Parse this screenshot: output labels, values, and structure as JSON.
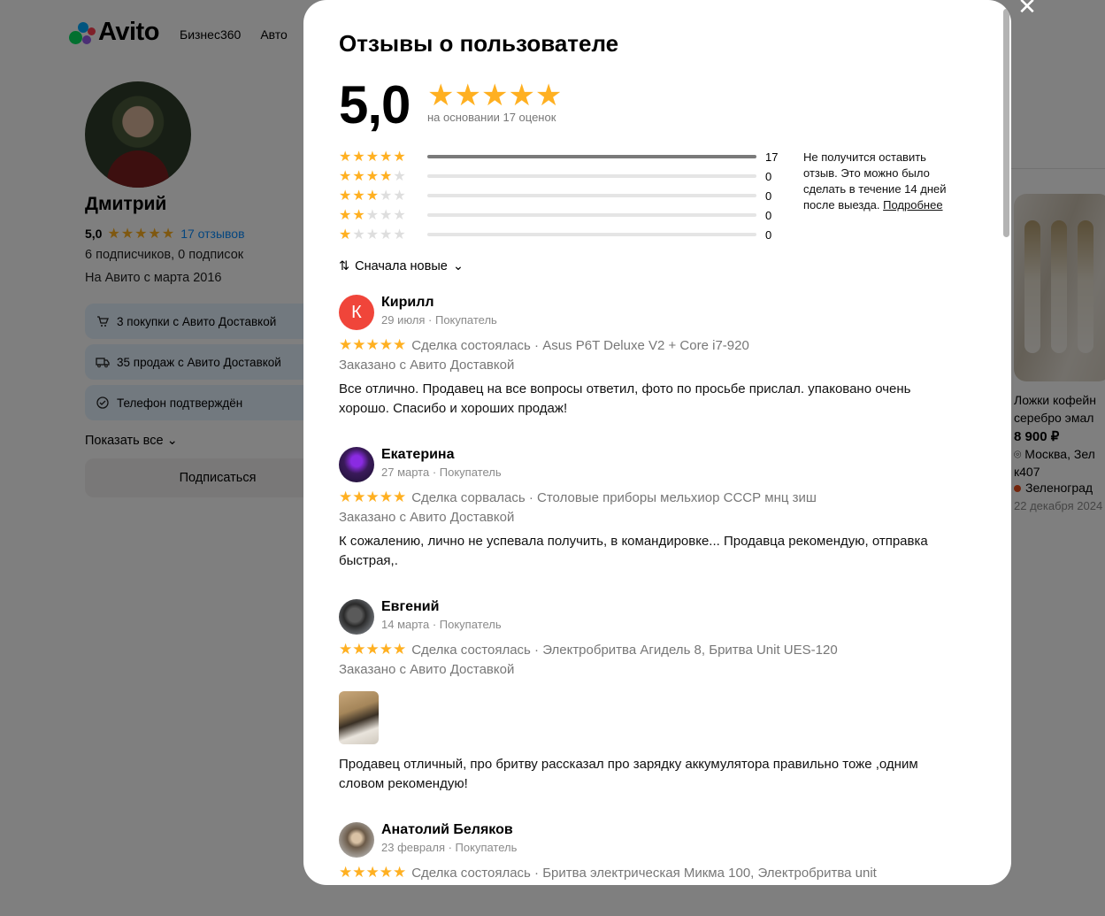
{
  "site": {
    "logo_text": "Avito",
    "nav": [
      "Бизнес360",
      "Авто"
    ]
  },
  "profile": {
    "name": "Дмитрий",
    "rating": "5,0",
    "reviews_link": "17 отзывов",
    "followers": "6 подписчиков, 0 подписок",
    "since": "На Авито с марта 2016",
    "badges": [
      {
        "icon": "cart-icon",
        "text": "3 покупки с Авито Доставкой"
      },
      {
        "icon": "truck-icon",
        "text": "35 продаж с Авито Доставкой"
      },
      {
        "icon": "check-circle-icon",
        "text": "Телефон подтверждён"
      }
    ],
    "show_all": "Показать все",
    "subscribe": "Подписаться"
  },
  "listing_card": {
    "title": "Ложки кофейн серебро эмал",
    "price": "8 900 ₽",
    "location": "Москва, Зел к407",
    "metro": "Зеленоград",
    "date": "22 декабря 2024"
  },
  "modal": {
    "title": "Отзывы о пользователе",
    "rating": "5,0",
    "based_on": "на основании 17 оценок",
    "distribution": [
      {
        "stars": 5,
        "count": "17",
        "fraction": 1.0
      },
      {
        "stars": 4,
        "count": "0",
        "fraction": 0
      },
      {
        "stars": 3,
        "count": "0",
        "fraction": 0
      },
      {
        "stars": 2,
        "count": "0",
        "fraction": 0
      },
      {
        "stars": 1,
        "count": "0",
        "fraction": 0
      }
    ],
    "note": "Не получится оставить отзыв. Это можно было сделать в течение 14 дней после выезда.",
    "note_link": "Подробнее",
    "sort_label": "Сначала новые",
    "reviews": [
      {
        "name": "Кирилл",
        "avatar_letter": "К",
        "meta": "29 июля · Покупатель",
        "deal": "Сделка состоялась · Asus P6T Deluxe V2 + Core i7-920",
        "delivery": "Заказано с Авито Доставкой",
        "text": "Все отлично. Продавец на все вопросы ответил, фото по просьбе прислал. упаковано очень хорошо. Спасибо и хороших продаж!"
      },
      {
        "name": "Екатерина",
        "meta": "27 марта · Покупатель",
        "deal": "Сделка сорвалась · Столовые приборы мельхиор СССР мнц зиш",
        "delivery": "Заказано с Авито Доставкой",
        "text": "К сожалению, лично не успевала получить, в командировке... Продавца рекомендую, отправка быстрая,."
      },
      {
        "name": "Евгений",
        "meta": "14 марта · Покупатель",
        "deal": "Сделка состоялась · Электробритва Агидель 8, Бритва Unit UES-120",
        "delivery": "Заказано с Авито Доставкой",
        "text": "Продавец отличный, про бритву рассказал про зарядку аккумулятора правильно тоже ,одним словом рекомендую!"
      },
      {
        "name": "Анатолий Беляков",
        "meta": "23 февраля · Покупатель",
        "deal": "Сделка состоялась · Бритва электрическая Микма 100, Электробритва unit"
      }
    ]
  },
  "colors": {
    "star": "#ffb021",
    "link": "#0a8cff",
    "badge_bg": "#e4f2ff",
    "avatar_kirill": "#f0453a"
  }
}
